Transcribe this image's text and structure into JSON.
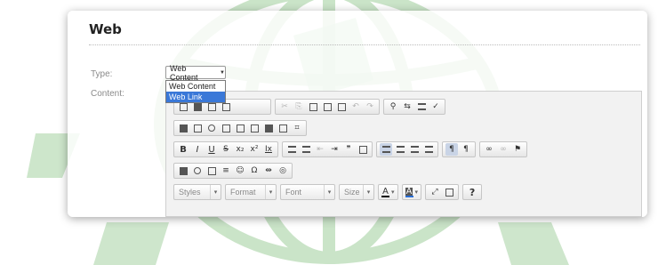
{
  "form": {
    "heading": "Web",
    "type_label": "Type:",
    "content_label": "Content:",
    "type_select": {
      "value": "Web Content",
      "options": [
        "Web Content",
        "Web Link"
      ],
      "highlighted": "Web Link"
    }
  },
  "editor": {
    "row1_groups": [
      [
        "source-icon",
        "save-icon",
        "new-page-icon",
        "preview-icon"
      ],
      [
        "cut-icon",
        "copy-icon",
        "paste-icon",
        "paste-text-icon",
        "paste-word-icon",
        "undo-icon",
        "redo-icon"
      ],
      [
        "find-icon",
        "replace-icon",
        "select-all-icon",
        "spellcheck-icon"
      ]
    ],
    "row2_groups": [
      [
        "form-icon",
        "checkbox-icon",
        "radio-icon",
        "textfield-icon",
        "textarea-icon",
        "select-field-icon",
        "button-icon",
        "image-button-icon",
        "hidden-field-icon"
      ]
    ],
    "row3": {
      "basic": [
        "B",
        "I",
        "U",
        "S",
        "x₂",
        "x²",
        "Ix"
      ],
      "paragraph": [
        "numbered-list-icon",
        "bulleted-list-icon",
        "outdent-icon",
        "indent-icon",
        "blockquote-icon",
        "div-icon"
      ],
      "align": [
        "align-left-icon",
        "align-center-icon",
        "align-right-icon",
        "justify-icon"
      ],
      "bidi": [
        "ltr-icon",
        "rtl-icon"
      ],
      "links": [
        "link-icon",
        "unlink-icon",
        "anchor-icon"
      ]
    },
    "row4_groups": [
      [
        "image-icon",
        "flash-icon",
        "table-icon",
        "horizontal-rule-icon",
        "smiley-icon",
        "special-char-icon",
        "page-break-icon",
        "iframe-icon"
      ]
    ],
    "row5": {
      "styles_label": "Styles",
      "format_label": "Format",
      "font_label": "Font",
      "size_label": "Size",
      "text_color_label": "A",
      "bg_color_label": "A",
      "about_label": "?",
      "text_color": "#000000",
      "bg_color": "#2a6fd6"
    }
  },
  "colors": {
    "watermark": "#b9dcb6",
    "highlight": "#3a78d8"
  }
}
